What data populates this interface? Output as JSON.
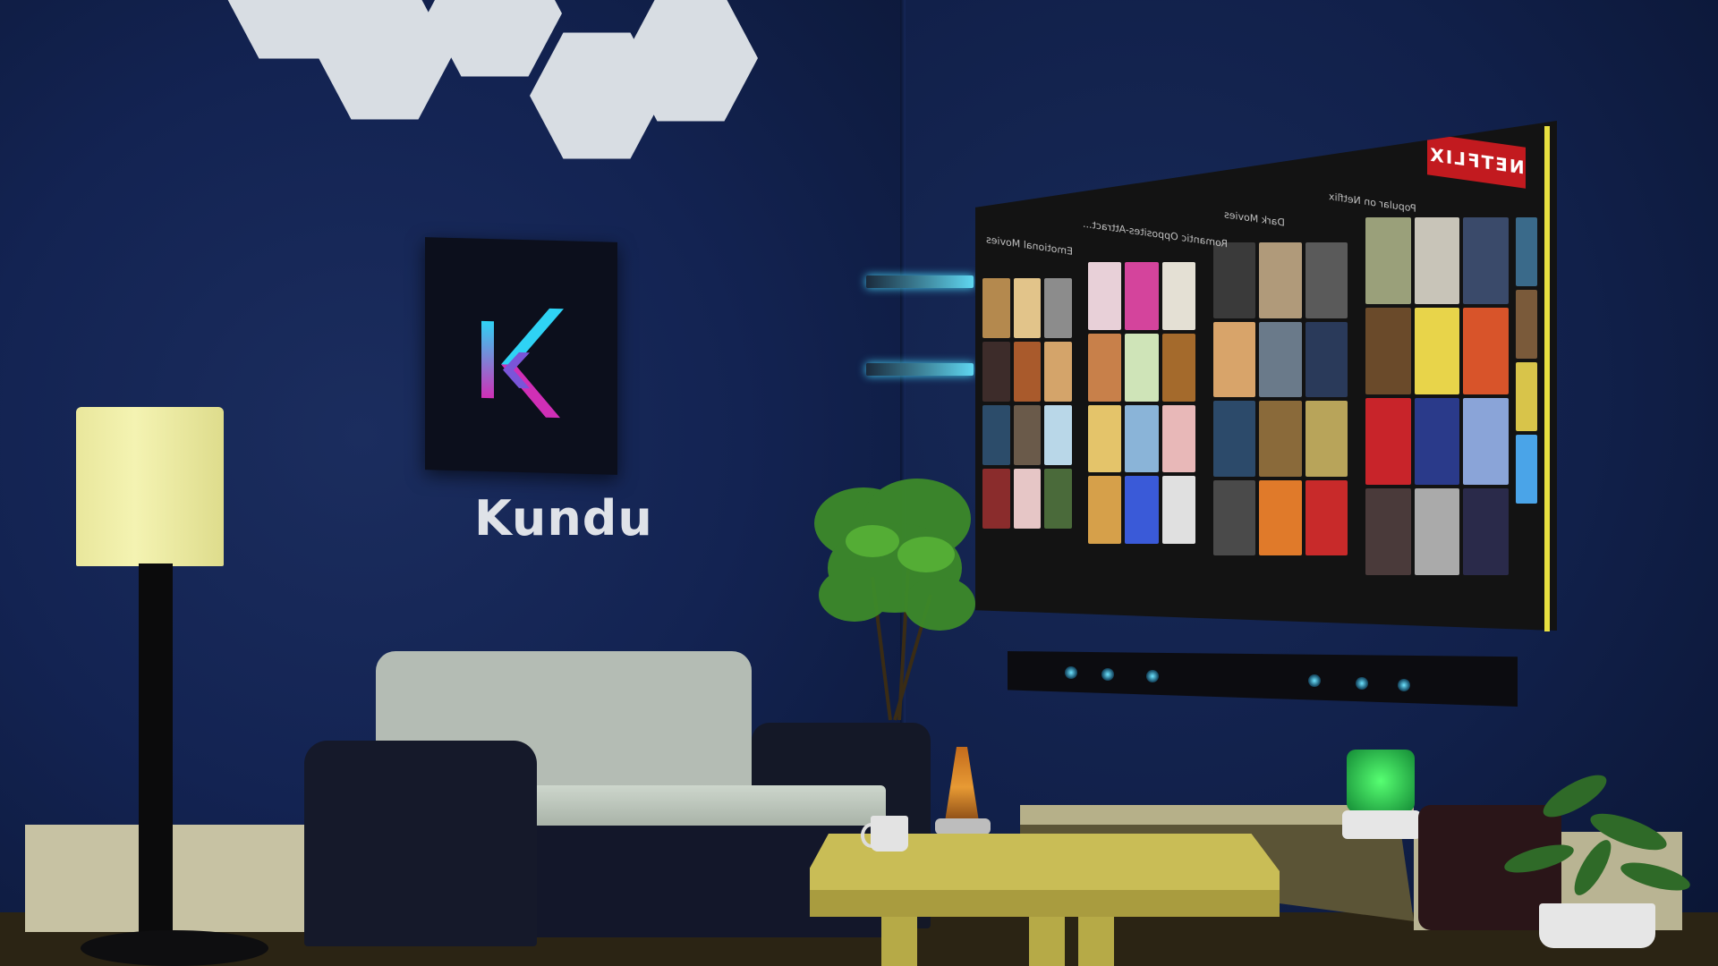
{
  "wall_logo": {
    "brand_name": "Kundu",
    "icon": "kundu-k-logo-icon",
    "colors": {
      "gradient_top": "#2fd3f5",
      "gradient_bottom": "#d02fb6",
      "background": "#0c0f1c"
    }
  },
  "tv_screen": {
    "service_logo": "NETFLIX",
    "rows": [
      {
        "label": "Popular on Netflix"
      },
      {
        "label": "Dark Movies"
      },
      {
        "label": "Romantic Opposites-Attract..."
      },
      {
        "label": "Emotional Movies"
      }
    ],
    "accent_color": "#c21a1f"
  },
  "room": {
    "wall_color": "#132352",
    "items": [
      "hexagon-light-panels",
      "floor-lamp",
      "sofa",
      "coffee-table",
      "mug",
      "lava-lamp",
      "floating-shelves",
      "potted-plant",
      "soundbar",
      "tv-stand",
      "glow-jar",
      "ottoman",
      "small-plant"
    ]
  }
}
